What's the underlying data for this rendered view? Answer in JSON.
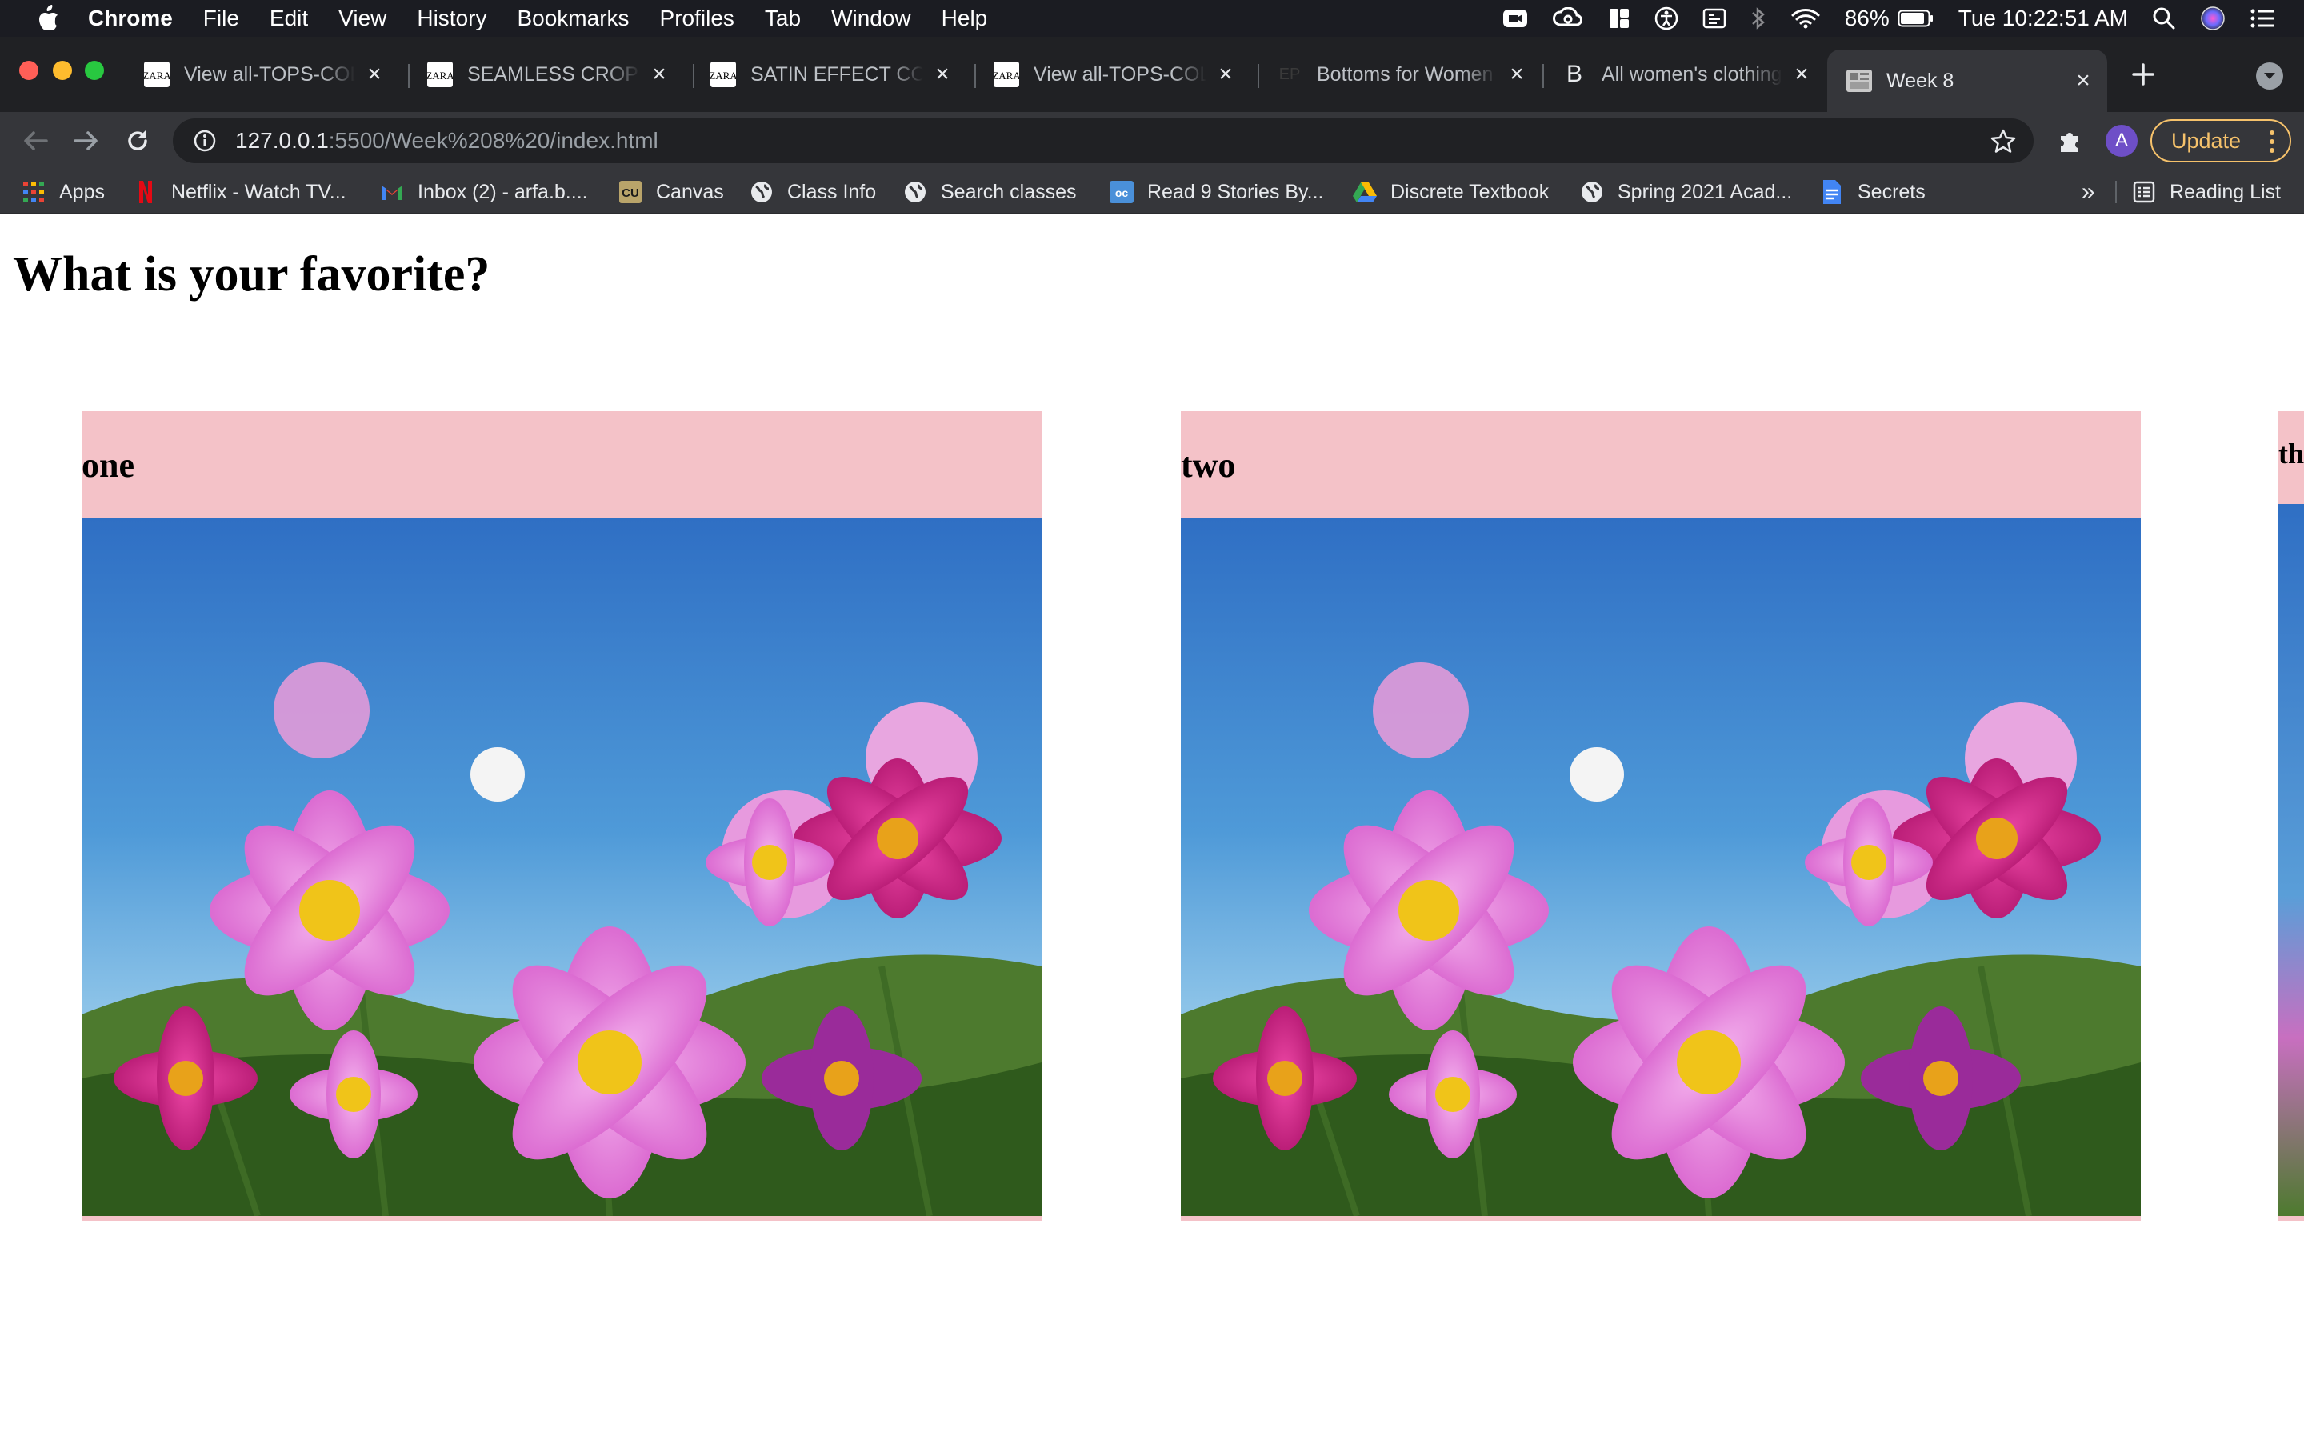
{
  "menubar": {
    "items": [
      "Chrome",
      "File",
      "Edit",
      "View",
      "History",
      "Bookmarks",
      "Profiles",
      "Tab",
      "Window",
      "Help"
    ],
    "battery": "86%",
    "clock": "Tue 10:22:51 AM"
  },
  "tabs": [
    {
      "title": "View all-TOPS-COL",
      "icon": "zara-icon"
    },
    {
      "title": "SEAMLESS CROP T",
      "icon": "zara-icon"
    },
    {
      "title": "SATIN EFFECT COR",
      "icon": "zara-icon"
    },
    {
      "title": "View all-TOPS-COL",
      "icon": "zara-icon"
    },
    {
      "title": "Bottoms for Women",
      "icon": "ep-icon",
      "icon_text": "EP"
    },
    {
      "title": "All women's clothing",
      "icon": "b-icon",
      "icon_text": "B"
    },
    {
      "title": "Week 8",
      "icon": "page-thumbnail-icon",
      "active": true
    }
  ],
  "toolbar": {
    "url_host": "127.0.0.1",
    "url_path": ":5500/Week%208%20/index.html",
    "avatar_letter": "A",
    "update_label": "Update"
  },
  "bookmarks": {
    "items": [
      {
        "label": "Apps",
        "icon": "apps-grid-icon"
      },
      {
        "label": "Netflix - Watch TV...",
        "icon": "netflix-icon"
      },
      {
        "label": "Inbox (2) - arfa.b....",
        "icon": "gmail-icon"
      },
      {
        "label": "Canvas",
        "icon": "cu-icon"
      },
      {
        "label": "Class Info",
        "icon": "globe-icon"
      },
      {
        "label": "Search classes",
        "icon": "globe-icon"
      },
      {
        "label": "Read 9 Stories By...",
        "icon": "oc-icon"
      },
      {
        "label": "Discrete Textbook",
        "icon": "drive-icon"
      },
      {
        "label": "Spring 2021 Acad...",
        "icon": "globe-icon"
      },
      {
        "label": "Secrets",
        "icon": "docs-icon"
      }
    ],
    "overflow": "»",
    "reading_list": "Reading List"
  },
  "page": {
    "heading": "What is your favorite?",
    "cards": [
      {
        "label": "one"
      },
      {
        "label": "two"
      },
      {
        "label": "th"
      }
    ]
  },
  "colors": {
    "card_background": "#f4c2c8",
    "update_accent": "#f6c26b"
  }
}
